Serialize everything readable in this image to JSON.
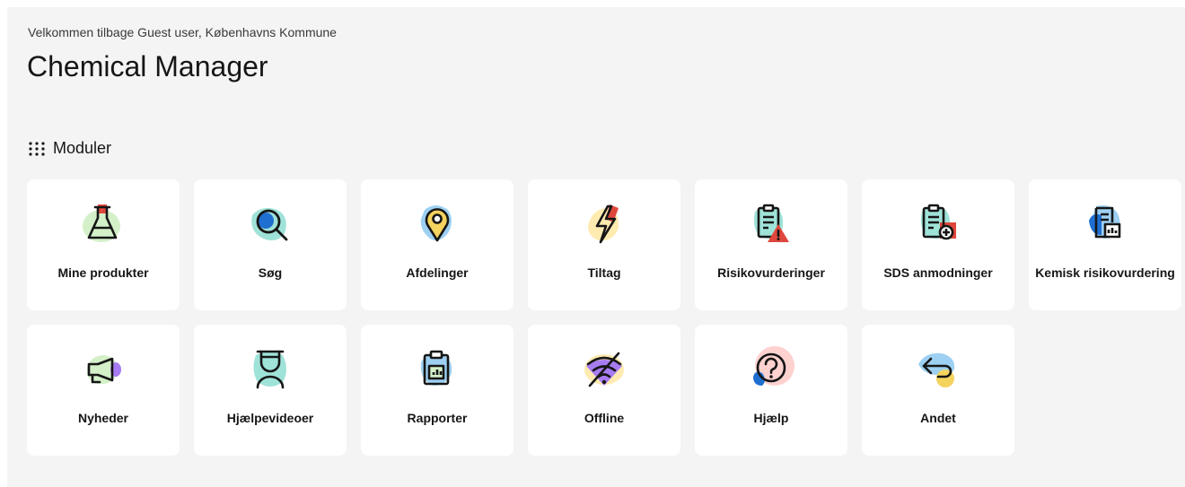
{
  "header": {
    "welcome": "Velkommen tilbage Guest user, Københavns Kommune",
    "title": "Chemical Manager"
  },
  "modules": {
    "heading": "Moduler",
    "heading_icon": "grid-dots-icon",
    "items": [
      {
        "label": "Mine produkter",
        "icon": "flask-icon"
      },
      {
        "label": "Søg",
        "icon": "magnifier-icon"
      },
      {
        "label": "Afdelinger",
        "icon": "location-pin-icon"
      },
      {
        "label": "Tiltag",
        "icon": "lightning-icon"
      },
      {
        "label": "Risikovurderinger",
        "icon": "clipboard-warning-icon"
      },
      {
        "label": "SDS anmodninger",
        "icon": "clipboard-add-icon"
      },
      {
        "label": "Kemisk risikovurdering",
        "icon": "document-chart-icon"
      },
      {
        "label": "Nyheder",
        "icon": "megaphone-icon"
      },
      {
        "label": "Hjælpevideoer",
        "icon": "graduate-icon"
      },
      {
        "label": "Rapporter",
        "icon": "report-clipboard-icon"
      },
      {
        "label": "Offline",
        "icon": "wifi-off-icon"
      },
      {
        "label": "Hjælp",
        "icon": "help-icon"
      },
      {
        "label": "Andet",
        "icon": "return-arrow-icon"
      }
    ]
  },
  "colors": {
    "page_bg": "#f4f4f4",
    "card_bg": "#ffffff",
    "blob_green": "#d4f0c8",
    "blob_teal": "#9fe2d8",
    "blob_blue": "#9dd0f2",
    "blob_yellow": "#ffeab0",
    "blob_pink": "#ffd2d0",
    "accent_red": "#e0473c",
    "accent_blue": "#1f6fd1",
    "accent_purple": "#a77cf2",
    "accent_yellow": "#f4d35e"
  }
}
